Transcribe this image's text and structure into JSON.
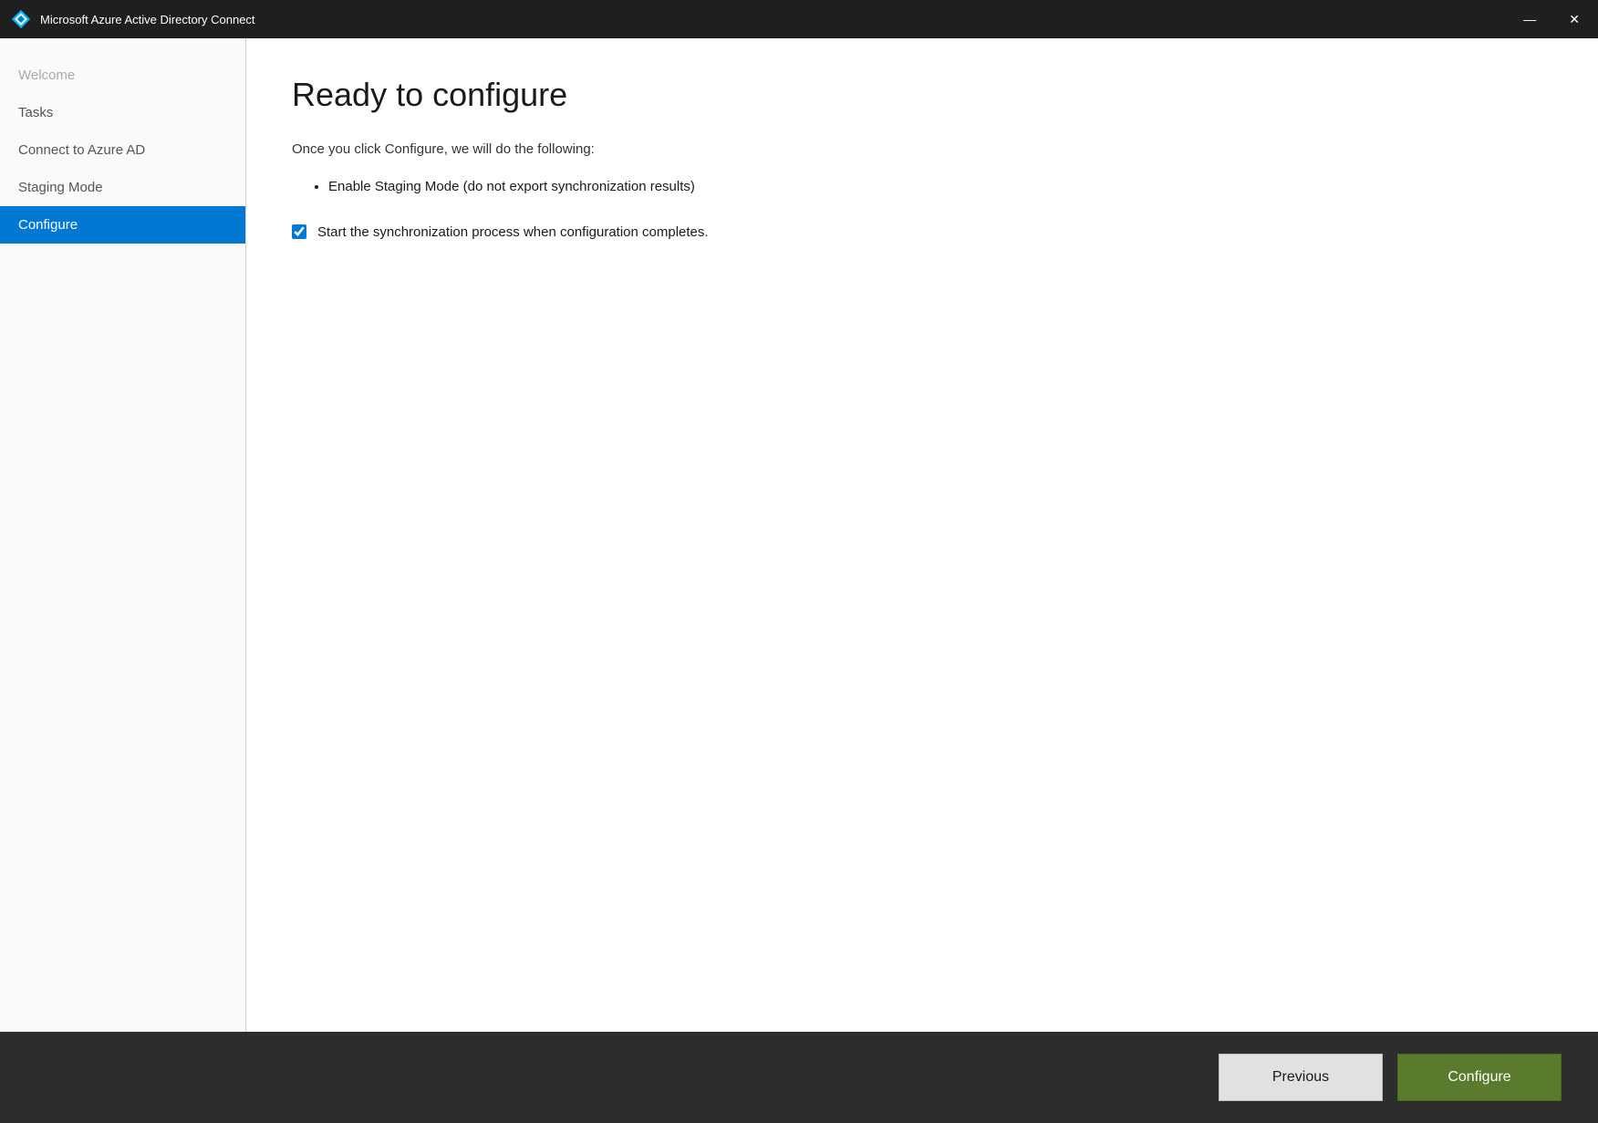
{
  "titlebar": {
    "title": "Microsoft Azure Active Directory Connect",
    "minimize_label": "—",
    "close_label": "✕"
  },
  "sidebar": {
    "items": [
      {
        "id": "welcome",
        "label": "Welcome",
        "state": "disabled"
      },
      {
        "id": "tasks",
        "label": "Tasks",
        "state": "normal"
      },
      {
        "id": "connect-azure-ad",
        "label": "Connect to Azure AD",
        "state": "normal"
      },
      {
        "id": "staging-mode",
        "label": "Staging Mode",
        "state": "normal"
      },
      {
        "id": "configure",
        "label": "Configure",
        "state": "active"
      }
    ]
  },
  "main": {
    "page_title": "Ready to configure",
    "description": "Once you click Configure, we will do the following:",
    "bullet_items": [
      "Enable Staging Mode (do not export synchronization results)"
    ],
    "checkbox_label": "Start the synchronization process when configuration completes.",
    "checkbox_checked": true
  },
  "footer": {
    "previous_label": "Previous",
    "configure_label": "Configure"
  }
}
